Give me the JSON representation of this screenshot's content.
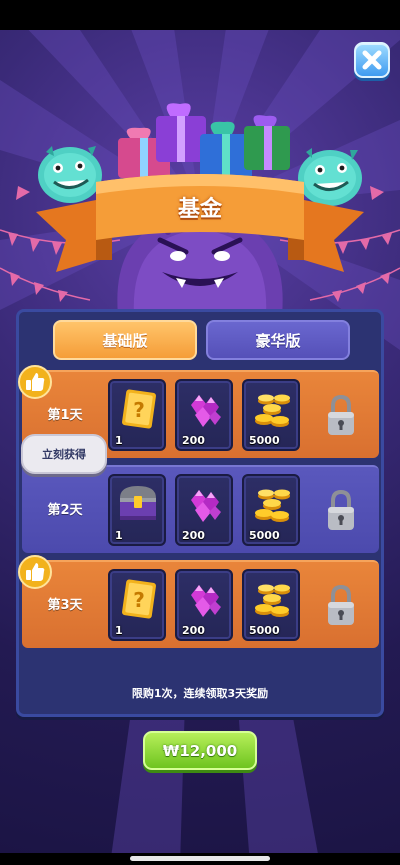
{
  "header": {
    "title": "基金"
  },
  "tabs": [
    {
      "label": "基础版",
      "active": true
    },
    {
      "label": "豪华版",
      "active": false
    }
  ],
  "rows": [
    {
      "day": "第1天",
      "liked": true,
      "items": [
        {
          "icon": "mystery-card-icon",
          "qty": "1"
        },
        {
          "icon": "gems-icon",
          "qty": "200"
        },
        {
          "icon": "gold-coins-icon",
          "qty": "5000"
        }
      ],
      "locked": true
    },
    {
      "day": "第2天",
      "liked": false,
      "items": [
        {
          "icon": "treasure-chest-icon",
          "qty": "1"
        },
        {
          "icon": "gems-icon",
          "qty": "200"
        },
        {
          "icon": "gold-coins-icon",
          "qty": "5000"
        }
      ],
      "locked": true
    },
    {
      "day": "第3天",
      "liked": true,
      "items": [
        {
          "icon": "mystery-card-icon",
          "qty": "1"
        },
        {
          "icon": "gems-icon",
          "qty": "200"
        },
        {
          "icon": "gold-coins-icon",
          "qty": "5000"
        }
      ],
      "locked": true
    }
  ],
  "tooltip": {
    "text": "立刻获得"
  },
  "footer": {
    "note": "限购1次，连续领取3天奖励"
  },
  "purchase": {
    "price": "₩12,000"
  },
  "colors": {
    "accent_orange": "#f59d38",
    "panel": "#2c3372",
    "buy_green": "#6fc41f",
    "close_blue": "#3e9bf0"
  }
}
